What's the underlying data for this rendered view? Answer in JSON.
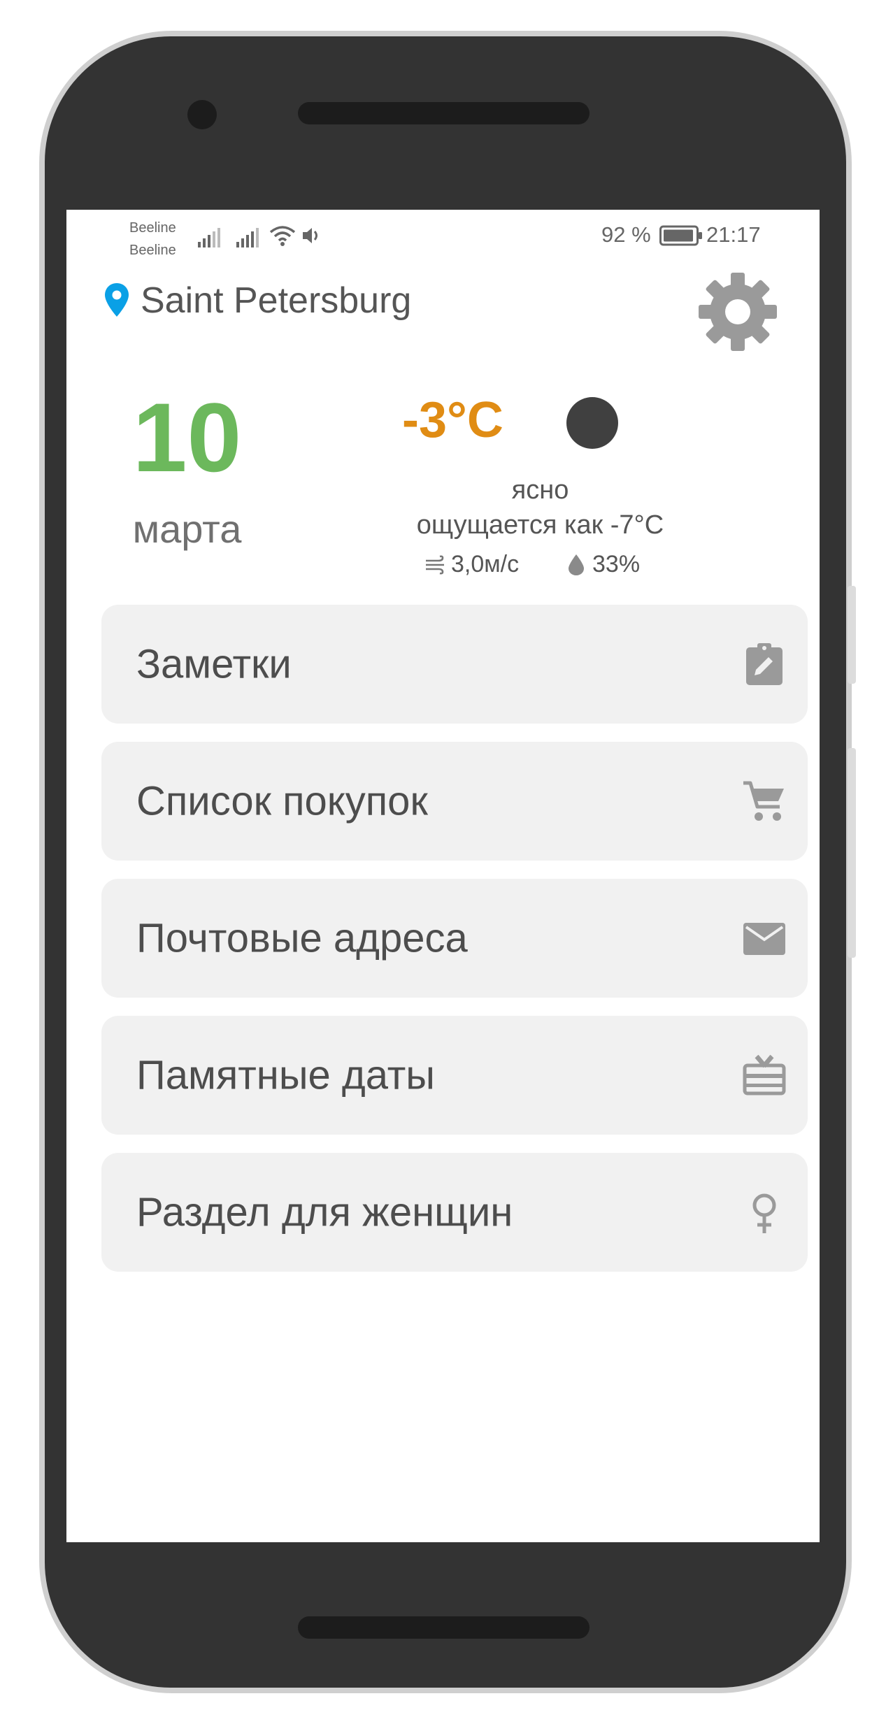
{
  "status_bar": {
    "carrier_1": "Beeline",
    "carrier_2": "Beeline",
    "battery_percent": "92 %",
    "time": "21:17"
  },
  "header": {
    "city": "Saint Petersburg",
    "icons": {
      "location": "location-pin-icon",
      "settings": "gear-icon"
    }
  },
  "date": {
    "day": "10",
    "month": "марта"
  },
  "weather": {
    "temperature": "-3°C",
    "icon": "moon-icon",
    "condition": "ясно",
    "feels_like": "ощущается как -7°C",
    "wind": "3,0м/с",
    "humidity": "33%"
  },
  "menu": [
    {
      "label": "Заметки",
      "icon": "clipboard-pencil-icon"
    },
    {
      "label": "Список покупок",
      "icon": "shopping-cart-icon"
    },
    {
      "label": "Почтовые адреса",
      "icon": "mail-icon"
    },
    {
      "label": "Памятные даты",
      "icon": "gift-card-icon"
    },
    {
      "label": "Раздел для женщин",
      "icon": "female-symbol-icon"
    }
  ],
  "colors": {
    "accent_green": "#6cb85c",
    "temperature_orange": "#e08c14",
    "pin_blue": "#0aa0e6",
    "icon_gray": "#9a9a9a",
    "card_bg": "#f1f1f1",
    "frame": "#333333"
  }
}
